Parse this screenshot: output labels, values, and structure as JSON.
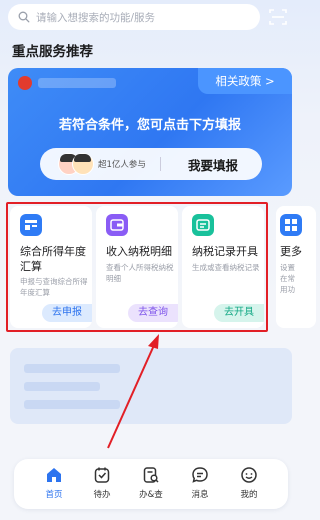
{
  "search": {
    "placeholder": "请输入想搜索的功能/服务"
  },
  "section": {
    "title": "重点服务推荐"
  },
  "banner": {
    "policy_tab": "相关政策 >",
    "headline": "若符合条件，您可点击下方填报",
    "participants": "超1亿人参与",
    "fill_button": "我要填报"
  },
  "cards": [
    {
      "title": "综合所得年度汇算",
      "desc": "申报与查询综合所得年度汇算",
      "action": "去申报",
      "icon": "annual-tax-icon",
      "icon_color": "#2f7bf5",
      "btn_bg": "#dceafe",
      "btn_color": "#2f74ee"
    },
    {
      "title": "收入纳税明细",
      "desc": "查看个人所得税纳税明细",
      "action": "去查询",
      "icon": "wallet-icon",
      "icon_color": "#8a5cf5",
      "btn_bg": "#ebe2fd",
      "btn_color": "#7d53ea"
    },
    {
      "title": "纳税记录开具",
      "desc": "生成或查看纳税记录",
      "action": "去开具",
      "icon": "record-icon",
      "icon_color": "#19c19b",
      "btn_bg": "#d6f4ec",
      "btn_color": "#14a885"
    },
    {
      "title": "更多",
      "desc": "设置在常用功",
      "action": "",
      "icon": "more-grid-icon",
      "icon_color": "#2f7bf5",
      "btn_bg": "",
      "btn_color": ""
    }
  ],
  "nav": [
    {
      "label": "首页",
      "icon": "home-icon",
      "active": true
    },
    {
      "label": "待办",
      "icon": "todo-icon",
      "active": false
    },
    {
      "label": "办&查",
      "icon": "handle-query-icon",
      "active": false
    },
    {
      "label": "消息",
      "icon": "message-icon",
      "active": false
    },
    {
      "label": "我的",
      "icon": "profile-icon",
      "active": false
    }
  ],
  "colors": {
    "accent": "#2d74ef",
    "highlight": "#e21f26",
    "banner": "#3f8cf7"
  }
}
